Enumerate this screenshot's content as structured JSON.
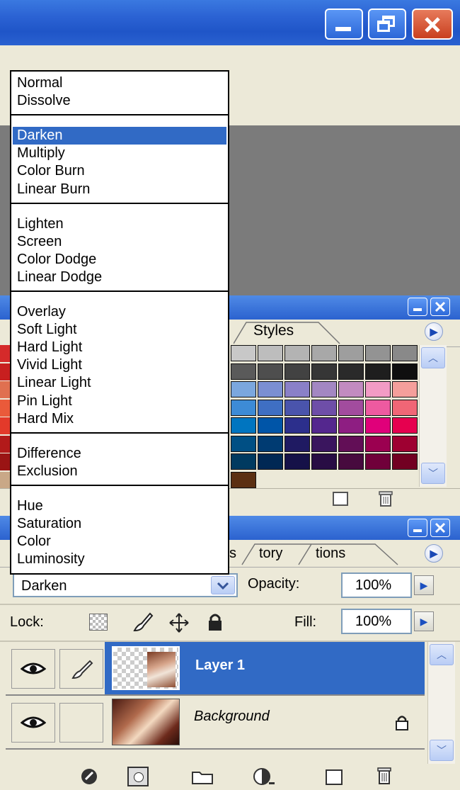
{
  "window": {
    "controls": [
      "minimize-button",
      "restore-button",
      "close-button"
    ]
  },
  "blend_menu": {
    "groups": [
      [
        "Normal",
        "Dissolve"
      ],
      [
        "Darken",
        "Multiply",
        "Color Burn",
        "Linear Burn"
      ],
      [
        "Lighten",
        "Screen",
        "Color Dodge",
        "Linear Dodge"
      ],
      [
        "Overlay",
        "Soft Light",
        "Hard Light",
        "Vivid Light",
        "Linear Light",
        "Pin Light",
        "Hard Mix"
      ],
      [
        "Difference",
        "Exclusion"
      ],
      [
        "Hue",
        "Saturation",
        "Color",
        "Luminosity"
      ]
    ],
    "selected": "Darken"
  },
  "styles_panel": {
    "tab_label": "Styles",
    "swatch_rows": [
      [
        "#c8c8c8",
        "#bdbdbd",
        "#b3b3b3",
        "#a8a8a8",
        "#9e9e9e",
        "#939393",
        "#898989"
      ],
      [
        "#5a5a5a",
        "#4e4e4e",
        "#424242",
        "#363636",
        "#2a2a2a",
        "#1e1e1e",
        "#0f0f0f"
      ],
      [
        "#7ba7de",
        "#7b8fd2",
        "#8a80c8",
        "#a387c2",
        "#c28bc0",
        "#f29bc5",
        "#f49f9b"
      ],
      [
        "#3d8bd6",
        "#3f6fc3",
        "#4a54ac",
        "#6e4ea8",
        "#a24c9e",
        "#ee5aa0",
        "#f06676"
      ],
      [
        "#0075c0",
        "#0055a8",
        "#2c2f8c",
        "#54278e",
        "#8e1e82",
        "#e0007a",
        "#e6004f"
      ],
      [
        "#004f84",
        "#003b72",
        "#1f1a62",
        "#3a155e",
        "#620e56",
        "#9b0050",
        "#9e0031"
      ],
      [
        "#003a60",
        "#002854",
        "#151148",
        "#280d44",
        "#470a3e",
        "#70003a",
        "#720022"
      ],
      [
        "#5b2f12"
      ]
    ]
  },
  "layers_panel": {
    "tabs": [
      "s",
      "tory",
      "tions"
    ],
    "blend_mode": "Darken",
    "opacity_label": "Opacity:",
    "opacity_value": "100%",
    "lock_label": "Lock:",
    "fill_label": "Fill:",
    "fill_value": "100%",
    "layers": [
      {
        "name": "Layer 1",
        "selected": true
      },
      {
        "name": "Background",
        "locked": true
      }
    ]
  },
  "colors": {
    "selection": "#316ac5",
    "titlebar": "#2c63d4"
  }
}
